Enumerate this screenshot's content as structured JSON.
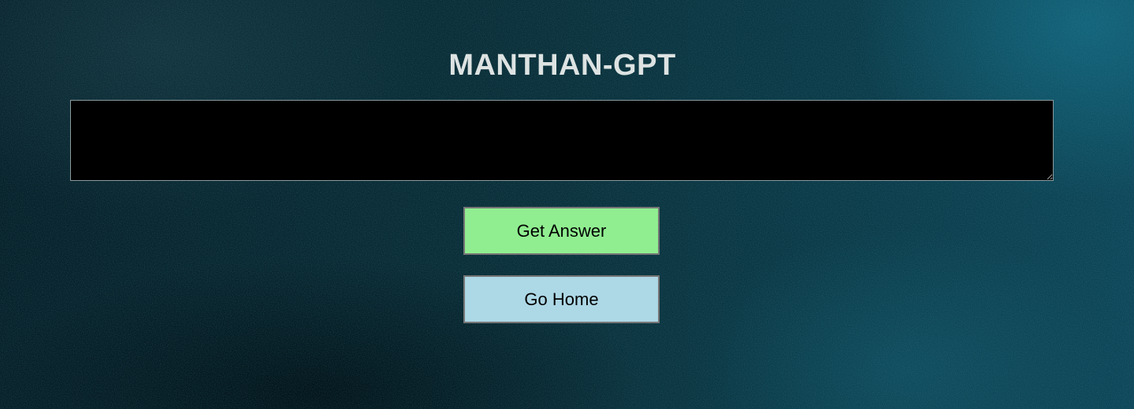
{
  "app": {
    "title": "MANTHAN-GPT"
  },
  "question": {
    "value": "",
    "placeholder": ""
  },
  "actions": {
    "get_answer_label": "Get Answer",
    "go_home_label": "Go Home"
  },
  "colors": {
    "background": "#0a2e38",
    "title_text": "#dde3e2",
    "input_background": "#000000",
    "get_answer_button": "#90ee90",
    "go_home_button": "#add8e6"
  }
}
